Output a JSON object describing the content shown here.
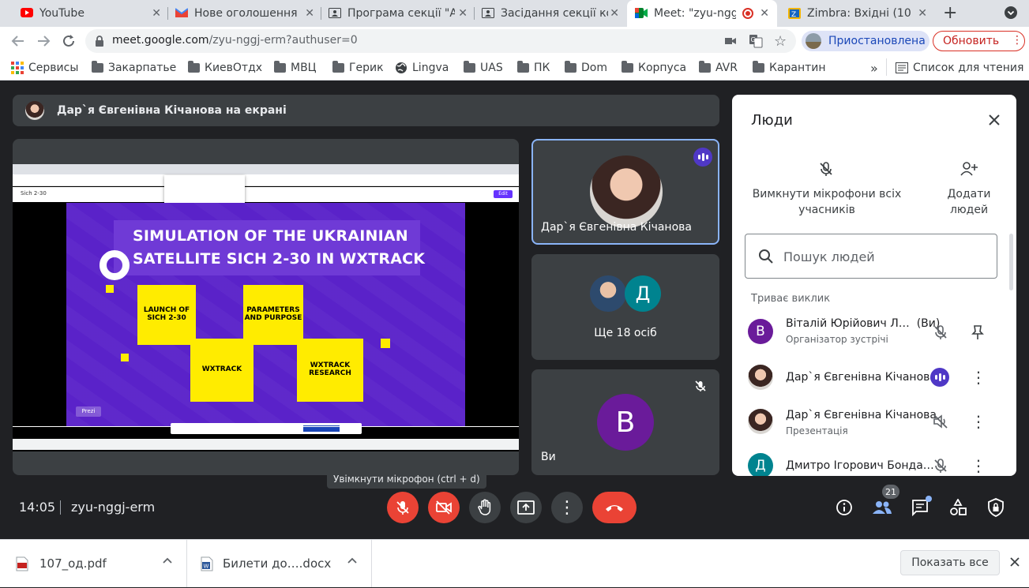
{
  "browser": {
    "tabs": [
      {
        "title": "YouTube",
        "active": false
      },
      {
        "title": "Нове оголошення",
        "active": false
      },
      {
        "title": "Програма секції \"А",
        "active": false
      },
      {
        "title": "Засідання секції ко",
        "active": false
      },
      {
        "title": "Meet: \"zyu-nggj",
        "active": true
      },
      {
        "title": "Zimbra: Вхідні (10",
        "active": false
      }
    ],
    "url_host": "meet.google.com",
    "url_path": "/zyu-nggj-erm?authuser=0",
    "profile_status": "Приостановлена",
    "update_label": "Обновить",
    "bookmarks": [
      "Сервисы",
      "Закарпатье",
      "КиевОтдх",
      "МВЦ",
      "Герик",
      "Lingva",
      "UAS",
      "ПК",
      "Dom",
      "Корпуса",
      "AVR",
      "Карантин"
    ],
    "reading_list": "Список для чтения",
    "more_bookmarks": "»"
  },
  "meet": {
    "presenter_banner": "Дар`я Євгенівна Кічанова на екрані",
    "slide": {
      "title_line1": "SIMULATION OF THE UKRAINIAN",
      "title_line2": "SATELLITE SICH 2-30 IN WXTRACK",
      "box1": "LAUNCH OF SICH 2-30",
      "box2": "PARAMETERS AND PURPOSE",
      "box3": "WXTRACK",
      "box4": "WXTRACK RESEARCH",
      "tab_label": "Sich 2-30",
      "edit_label": "Edit",
      "prezi": "Prezi"
    },
    "tiles": {
      "speaker_name": "Дар`я Євгенівна Кічанова",
      "others_label": "Ще 18 осіб",
      "others_avatar_letter": "Д",
      "you_label": "Ви",
      "you_avatar_letter": "В"
    },
    "tooltip": "Увімкнути мікрофон (ctrl + d)",
    "time": "14:05",
    "meeting_code": "zyu-nggj-erm",
    "people_count": "21"
  },
  "people_panel": {
    "title": "Люди",
    "mute_all_label": "Вимкнути мікрофони всіх учасників",
    "add_people_label": "Додати людей",
    "search_placeholder": "Пошук людей",
    "section_label": "Триває виклик",
    "participants": [
      {
        "name": "Віталій Юрійович Л…",
        "suffix": "(Ви)",
        "sub": "Організатор зустрічі",
        "letter": "В",
        "color": "#6a1b9a"
      },
      {
        "name": "Дар`я Євгенівна Кічанова",
        "suffix": "",
        "sub": "",
        "letter": "",
        "color": ""
      },
      {
        "name": "Дар`я Євгенівна Кічанова",
        "suffix": "",
        "sub": "Презентація",
        "letter": "",
        "color": ""
      },
      {
        "name": "Дмитро Ігорович Бонда…",
        "suffix": "",
        "sub": "",
        "letter": "Д",
        "color": "#00838f"
      }
    ]
  },
  "downloads": {
    "items": [
      {
        "name": "107_од.pdf"
      },
      {
        "name": "Билети до….docx"
      }
    ],
    "show_all": "Показать все"
  }
}
